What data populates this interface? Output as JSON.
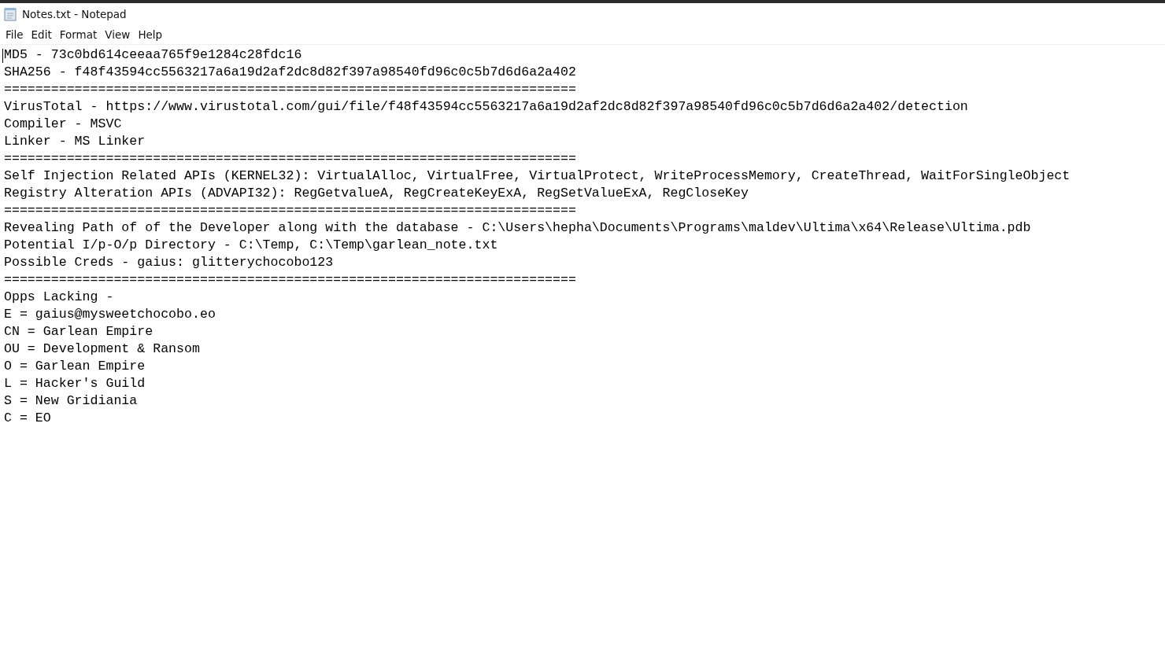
{
  "window": {
    "title": "Notes.txt - Notepad"
  },
  "menu": [
    "File",
    "Edit",
    "Format",
    "View",
    "Help"
  ],
  "editor": {
    "lines": [
      "MD5 - 73c0bd614ceeaa765f9e1284c28fdc16",
      "SHA256 - f48f43594cc5563217a6a19d2af2dc8d82f397a98540fd96c0c5b7d6d6a2a402",
      "=========================================================================",
      "VirusTotal - https://www.virustotal.com/gui/file/f48f43594cc5563217a6a19d2af2dc8d82f397a98540fd96c0c5b7d6d6a2a402/detection",
      "Compiler - MSVC",
      "Linker - MS Linker",
      "=========================================================================",
      "Self Injection Related APIs (KERNEL32): VirtualAlloc, VirtualFree, VirtualProtect, WriteProcessMemory, CreateThread, WaitForSingleObject",
      "Registry Alteration APIs (ADVAPI32): RegGetvalueA, RegCreateKeyExA, RegSetValueExA, RegCloseKey",
      "=========================================================================",
      "Revealing Path of of the Developer along with the database - C:\\Users\\hepha\\Documents\\Programs\\maldev\\Ultima\\x64\\Release\\Ultima.pdb",
      "Potential I/p-O/p Directory - C:\\Temp, C:\\Temp\\garlean_note.txt",
      "Possible Creds - gaius: glitterychocobo123",
      "=========================================================================",
      "Opps Lacking -",
      "E = gaius@mysweetchocobo.eo",
      "CN = Garlean Empire",
      "OU = Development & Ransom",
      "O = Garlean Empire",
      "L = Hacker's Guild",
      "S = New Gridiania",
      "C = EO"
    ]
  }
}
